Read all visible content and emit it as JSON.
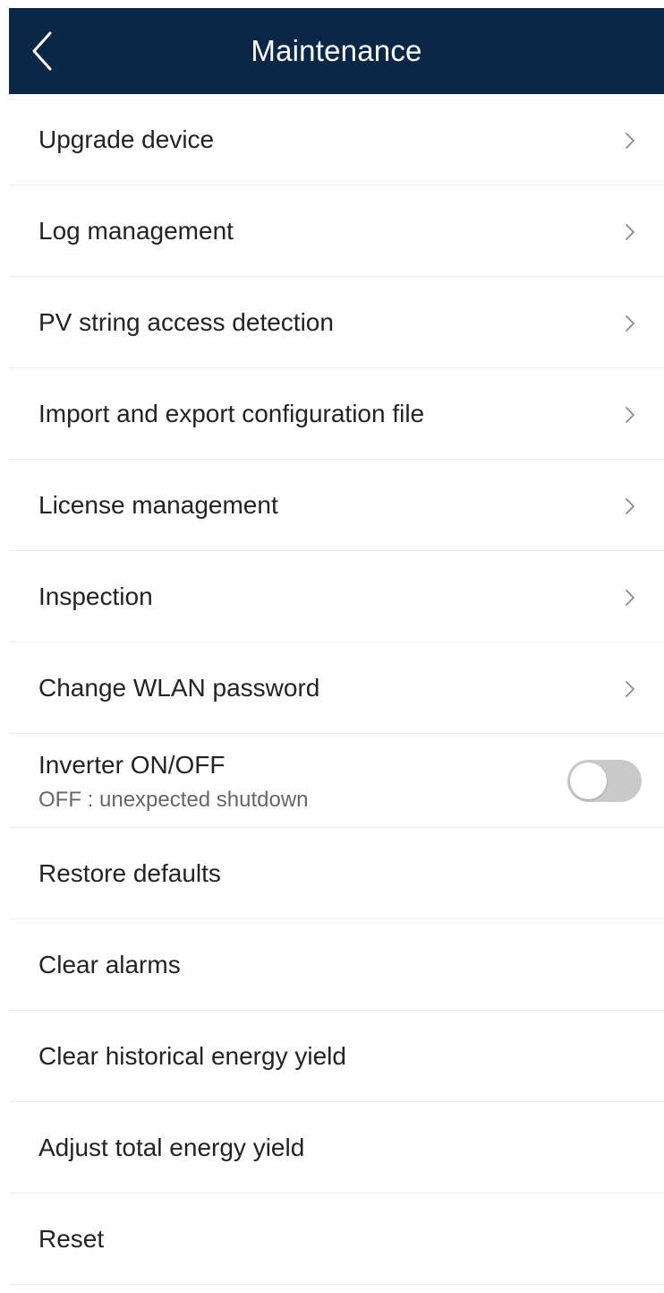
{
  "header": {
    "title": "Maintenance",
    "back_icon": "chevron-left-icon",
    "background_color": "#0b2748"
  },
  "items": [
    {
      "label": "Upgrade device",
      "icon": "chevron-right-icon"
    },
    {
      "label": "Log management",
      "icon": "chevron-right-icon"
    },
    {
      "label": "PV string access detection",
      "icon": "chevron-right-icon"
    },
    {
      "label": "Import and export configuration file",
      "icon": "chevron-right-icon"
    },
    {
      "label": "License management",
      "icon": "chevron-right-icon"
    },
    {
      "label": "Inspection",
      "icon": "chevron-right-icon"
    },
    {
      "label": "Change WLAN password",
      "icon": "chevron-right-icon"
    }
  ],
  "inverter": {
    "label": "Inverter ON/OFF",
    "status": "OFF : unexpected shutdown",
    "toggle_on": false
  },
  "actions": [
    {
      "label": "Restore defaults"
    },
    {
      "label": "Clear alarms"
    },
    {
      "label": "Clear historical energy yield"
    },
    {
      "label": "Adjust total energy yield"
    },
    {
      "label": "Reset"
    }
  ]
}
